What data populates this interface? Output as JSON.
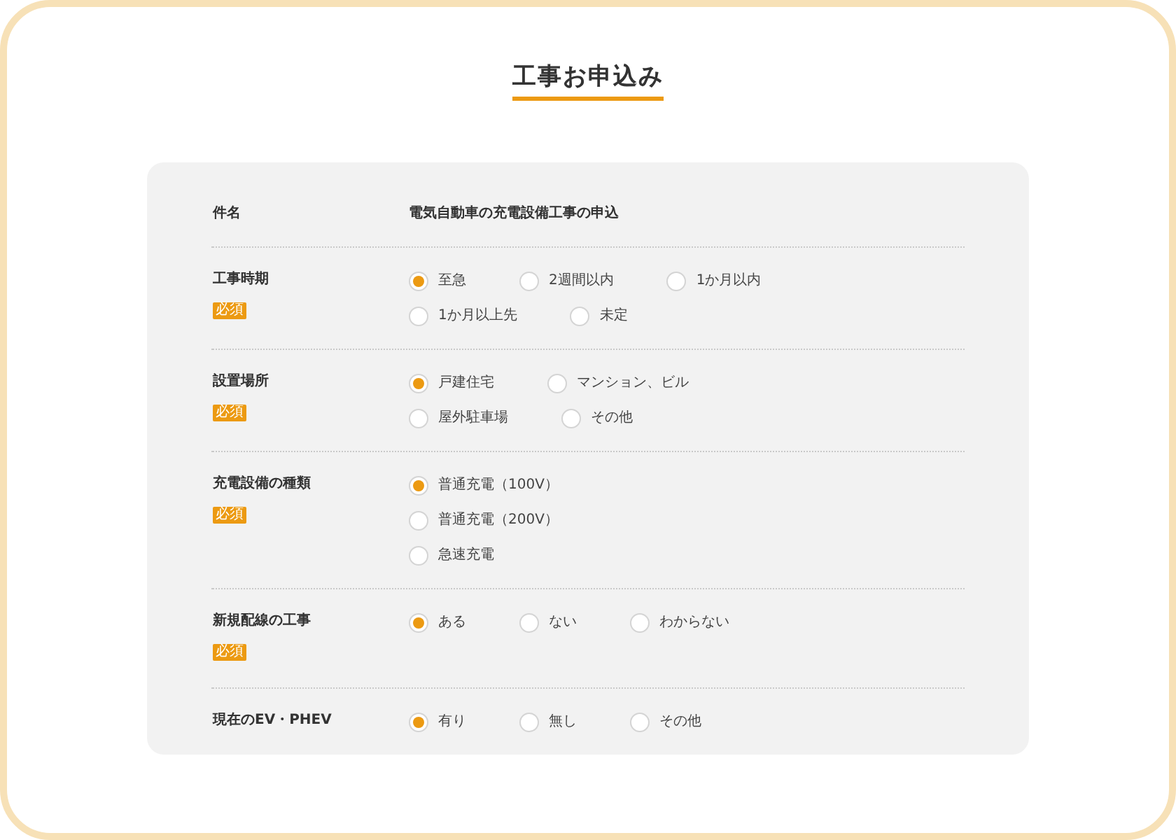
{
  "title": "工事お申込み",
  "rows": [
    {
      "kind": "text",
      "label": "件名",
      "required": false,
      "value": "電気自動車の充電設備工事の申込"
    },
    {
      "kind": "radio",
      "label": "工事時期",
      "required": true,
      "badge": "必須",
      "option_rows": [
        [
          {
            "label": "至急",
            "selected": true
          },
          {
            "label": "2週間以内",
            "selected": false
          },
          {
            "label": "1か月以内",
            "selected": false
          }
        ],
        [
          {
            "label": "1か月以上先",
            "selected": false
          },
          {
            "label": "未定",
            "selected": false
          }
        ]
      ]
    },
    {
      "kind": "radio",
      "label": "設置場所",
      "required": true,
      "badge": "必須",
      "option_rows": [
        [
          {
            "label": "戸建住宅",
            "selected": true
          },
          {
            "label": "マンション、ビル",
            "selected": false
          }
        ],
        [
          {
            "label": "屋外駐車場",
            "selected": false
          },
          {
            "label": "その他",
            "selected": false
          }
        ]
      ]
    },
    {
      "kind": "radio",
      "label": "充電設備の種類",
      "required": true,
      "badge": "必須",
      "option_rows": [
        [
          {
            "label": "普通充電（100V）",
            "selected": true
          }
        ],
        [
          {
            "label": "普通充電（200V）",
            "selected": false
          }
        ],
        [
          {
            "label": "急速充電",
            "selected": false
          }
        ]
      ]
    },
    {
      "kind": "radio",
      "label": "新規配線の工事",
      "required": true,
      "badge": "必須",
      "option_rows": [
        [
          {
            "label": "ある",
            "selected": true
          },
          {
            "label": "ない",
            "selected": false
          },
          {
            "label": "わからない",
            "selected": false
          }
        ]
      ]
    },
    {
      "kind": "radio",
      "label": "現在のEV・PHEV",
      "required": false,
      "option_rows": [
        [
          {
            "label": "有り",
            "selected": true
          },
          {
            "label": "無し",
            "selected": false
          },
          {
            "label": "その他",
            "selected": false
          }
        ]
      ]
    }
  ]
}
